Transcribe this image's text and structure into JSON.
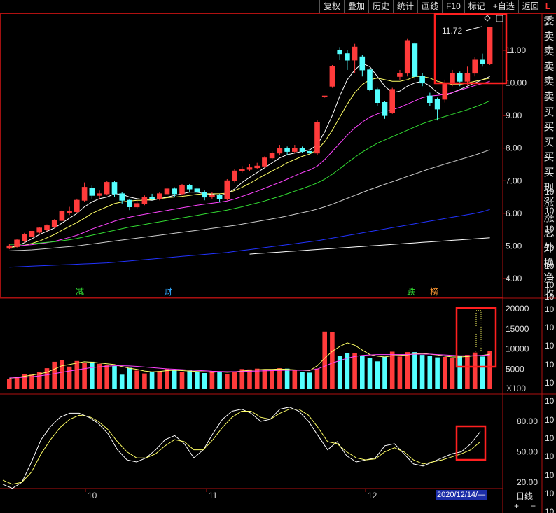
{
  "toolbar": {
    "buttons": [
      "复权",
      "叠加",
      "历史",
      "统计",
      "画线",
      "F10",
      "标记",
      "+自选",
      "返回"
    ],
    "flag": "L"
  },
  "side_panel": [
    "委",
    "卖",
    "卖",
    "卖",
    "卖",
    "卖",
    "买",
    "买",
    "买",
    "买",
    "买",
    "现",
    "涨",
    "涨",
    "总",
    "外",
    "换",
    "净",
    "收"
  ],
  "bottom": {
    "period": "日线",
    "date_box": "2020/12/14/—",
    "plus": "+",
    "minus": "−",
    "x100": "X100"
  },
  "price_axis": [
    "11.00",
    "10.00",
    "9.00",
    "8.00",
    "7.00",
    "6.00",
    "5.00",
    "4.00"
  ],
  "volume_axis": [
    "20000",
    "15000",
    "10000",
    "5000"
  ],
  "kdj_axis": [
    "80.00",
    "50.00",
    "20.00"
  ],
  "right_marks": [
    "10",
    "10",
    "10",
    "10",
    "10",
    "10",
    "10",
    "10",
    "10",
    "10",
    "10",
    "10",
    "10",
    "10",
    "10",
    "10",
    "10",
    "10",
    "10",
    "10"
  ],
  "dates": [
    "10",
    "11",
    "12"
  ],
  "markers": [
    {
      "text": "减",
      "color": "#33dd33"
    },
    {
      "text": "财",
      "color": "#33aaff"
    },
    {
      "text": "跌",
      "color": "#33dd33"
    },
    {
      "text": "榜",
      "color": "#ff9933"
    }
  ],
  "annotation": {
    "high_label": "11.72"
  },
  "colors": {
    "up": "#ff3b3b",
    "down": "#54ffff",
    "ma_white": "#ffffff",
    "ma_yellow": "#ffff66",
    "ma_magenta": "#ff44ff",
    "ma_green": "#33dd33",
    "ma_gray": "#cccccc",
    "ma_blue": "#2233ff",
    "highlight_box": "#ff2020"
  },
  "chart_data": {
    "type": "candlestick",
    "price_ylim": [
      3.6,
      12.6
    ],
    "volume_ylim": [
      0,
      22000
    ],
    "kdj_ylim": [
      10,
      100
    ],
    "candles": [
      [
        4.93,
        5.0,
        4.9,
        5.05
      ],
      [
        4.98,
        5.18,
        4.95,
        5.2
      ],
      [
        5.15,
        5.35,
        5.1,
        5.4
      ],
      [
        5.3,
        5.45,
        5.25,
        5.5
      ],
      [
        5.42,
        5.55,
        5.38,
        5.58
      ],
      [
        5.5,
        5.62,
        5.45,
        5.66
      ],
      [
        5.6,
        5.78,
        5.55,
        5.82
      ],
      [
        5.78,
        6.05,
        5.72,
        6.1
      ],
      [
        6.05,
        6.05,
        5.95,
        6.2
      ],
      [
        6.05,
        6.4,
        6.0,
        6.45
      ],
      [
        6.4,
        6.8,
        6.35,
        6.95
      ],
      [
        6.78,
        6.55,
        6.45,
        6.85
      ],
      [
        6.55,
        6.6,
        6.45,
        6.7
      ],
      [
        6.6,
        6.95,
        6.55,
        7.0
      ],
      [
        6.95,
        6.6,
        6.5,
        7.0
      ],
      [
        6.6,
        6.4,
        6.3,
        6.65
      ],
      [
        6.4,
        6.2,
        6.1,
        6.45
      ],
      [
        6.2,
        6.3,
        6.15,
        6.4
      ],
      [
        6.3,
        6.5,
        6.25,
        6.55
      ],
      [
        6.5,
        6.45,
        6.4,
        6.6
      ],
      [
        6.45,
        6.6,
        6.4,
        6.65
      ],
      [
        6.6,
        6.75,
        6.55,
        6.8
      ],
      [
        6.75,
        6.6,
        6.5,
        6.8
      ],
      [
        6.6,
        6.85,
        6.55,
        6.9
      ],
      [
        6.85,
        6.75,
        6.65,
        6.9
      ],
      [
        6.75,
        6.65,
        6.55,
        6.8
      ],
      [
        6.65,
        6.5,
        6.4,
        6.7
      ],
      [
        6.5,
        6.55,
        6.45,
        6.65
      ],
      [
        6.55,
        6.45,
        6.35,
        6.6
      ],
      [
        6.45,
        7.0,
        6.4,
        7.05
      ],
      [
        7.0,
        7.3,
        6.95,
        7.35
      ],
      [
        7.3,
        7.35,
        7.25,
        7.45
      ],
      [
        7.35,
        7.4,
        7.3,
        7.5
      ],
      [
        7.4,
        7.45,
        7.35,
        7.55
      ],
      [
        7.45,
        7.7,
        7.4,
        7.75
      ],
      [
        7.7,
        7.85,
        7.65,
        7.9
      ],
      [
        7.85,
        8.0,
        7.8,
        8.1
      ],
      [
        8.0,
        7.9,
        7.8,
        8.05
      ],
      [
        7.9,
        8.0,
        7.85,
        8.1
      ],
      [
        8.0,
        7.9,
        7.85,
        8.05
      ],
      [
        7.9,
        7.85,
        7.8,
        7.95
      ],
      [
        7.85,
        8.8,
        7.8,
        8.85
      ],
      [
        9.6,
        9.6,
        9.55,
        9.6
      ],
      [
        9.9,
        10.5,
        9.85,
        10.55
      ],
      [
        11.0,
        10.9,
        10.7,
        11.1
      ],
      [
        10.9,
        10.7,
        10.4,
        11.0
      ],
      [
        10.7,
        11.1,
        10.3,
        11.2
      ],
      [
        10.8,
        10.4,
        10.2,
        10.85
      ],
      [
        10.4,
        9.8,
        9.75,
        10.45
      ],
      [
        9.8,
        9.4,
        9.3,
        9.85
      ],
      [
        9.4,
        9.0,
        8.9,
        9.45
      ],
      [
        9.1,
        9.8,
        9.05,
        9.85
      ],
      [
        10.2,
        10.3,
        10.1,
        10.4
      ],
      [
        10.3,
        11.3,
        10.2,
        11.35
      ],
      [
        11.2,
        10.2,
        10.1,
        11.25
      ],
      [
        10.2,
        10.0,
        9.9,
        10.3
      ],
      [
        9.6,
        9.4,
        9.3,
        9.7
      ],
      [
        9.5,
        9.2,
        8.85,
        9.55
      ],
      [
        9.5,
        10.0,
        9.4,
        10.1
      ],
      [
        10.0,
        10.3,
        9.9,
        10.4
      ],
      [
        10.3,
        10.05,
        9.9,
        10.35
      ],
      [
        10.05,
        10.3,
        9.95,
        10.5
      ],
      [
        10.3,
        10.7,
        10.2,
        10.8
      ],
      [
        10.7,
        10.6,
        10.5,
        10.9
      ],
      [
        10.6,
        11.7,
        10.55,
        11.72
      ]
    ],
    "volumes": [
      2500,
      2800,
      3800,
      3600,
      4200,
      5200,
      6800,
      7300,
      5600,
      7000,
      6500,
      6800,
      6300,
      6000,
      5800,
      3600,
      5300,
      4600,
      3900,
      4200,
      4500,
      5100,
      4600,
      4200,
      4600,
      4300,
      4000,
      4500,
      4300,
      3800,
      4400,
      5000,
      4900,
      5100,
      4900,
      4700,
      5200,
      5100,
      4600,
      4300,
      4100,
      5100,
      14300,
      14100,
      8200,
      9000,
      8900,
      8300,
      7800,
      6900,
      8100,
      9300,
      8100,
      9200,
      9200,
      8500,
      8300,
      7900,
      8000,
      7700,
      8200,
      8500,
      9100,
      8100,
      9400
    ],
    "ma": [
      {
        "color": "ffffff",
        "values": [
          4.95,
          5.0,
          5.1,
          5.22,
          5.35,
          5.45,
          5.55,
          5.7,
          5.85,
          6.0,
          6.2,
          6.35,
          6.45,
          6.5,
          6.6,
          6.58,
          6.5,
          6.45,
          6.42,
          6.4,
          6.45,
          6.5,
          6.55,
          6.6,
          6.65,
          6.65,
          6.6,
          6.58,
          6.55,
          6.6,
          6.75,
          6.95,
          7.1,
          7.25,
          7.4,
          7.55,
          7.7,
          7.8,
          7.85,
          7.9,
          7.95,
          8.1,
          8.5,
          9.0,
          9.6,
          10.1,
          10.4,
          10.6,
          10.5,
          10.2,
          9.9,
          9.7,
          9.75,
          9.9,
          10.0,
          10.05,
          9.9,
          9.7,
          9.6,
          9.7,
          9.8,
          9.9,
          10.0,
          10.1,
          10.2
        ]
      },
      {
        "color": "ffff66",
        "values": [
          4.95,
          4.98,
          5.02,
          5.08,
          5.15,
          5.25,
          5.35,
          5.48,
          5.6,
          5.72,
          5.85,
          6.0,
          6.1,
          6.2,
          6.3,
          6.35,
          6.38,
          6.4,
          6.4,
          6.42,
          6.45,
          6.48,
          6.5,
          6.52,
          6.55,
          6.58,
          6.6,
          6.6,
          6.6,
          6.62,
          6.7,
          6.8,
          6.92,
          7.05,
          7.18,
          7.3,
          7.42,
          7.55,
          7.65,
          7.75,
          7.82,
          7.95,
          8.2,
          8.55,
          8.95,
          9.35,
          9.7,
          9.95,
          10.1,
          10.15,
          10.1,
          10.05,
          10.05,
          10.1,
          10.2,
          10.2,
          10.15,
          10.05,
          10.0,
          9.95,
          9.95,
          10.0,
          10.05,
          10.1,
          10.15
        ]
      },
      {
        "color": "ff44ff",
        "values": [
          5.0,
          5.0,
          5.02,
          5.04,
          5.07,
          5.1,
          5.14,
          5.2,
          5.26,
          5.33,
          5.42,
          5.52,
          5.6,
          5.68,
          5.76,
          5.83,
          5.88,
          5.93,
          5.97,
          6.01,
          6.05,
          6.09,
          6.13,
          6.17,
          6.21,
          6.25,
          6.28,
          6.31,
          6.34,
          6.38,
          6.44,
          6.52,
          6.6,
          6.68,
          6.77,
          6.86,
          6.95,
          7.05,
          7.15,
          7.25,
          7.33,
          7.45,
          7.65,
          7.9,
          8.15,
          8.4,
          8.62,
          8.8,
          8.95,
          9.05,
          9.12,
          9.18,
          9.25,
          9.35,
          9.45,
          9.55,
          9.6,
          9.62,
          9.65,
          9.7,
          9.78,
          9.85,
          9.92,
          9.98,
          10.05
        ]
      },
      {
        "color": "33dd33",
        "values": [
          5.05,
          5.05,
          5.06,
          5.07,
          5.09,
          5.11,
          5.13,
          5.16,
          5.19,
          5.23,
          5.28,
          5.33,
          5.38,
          5.43,
          5.48,
          5.53,
          5.58,
          5.62,
          5.66,
          5.7,
          5.74,
          5.78,
          5.82,
          5.86,
          5.9,
          5.94,
          5.98,
          6.02,
          6.06,
          6.1,
          6.15,
          6.2,
          6.26,
          6.32,
          6.38,
          6.45,
          6.52,
          6.6,
          6.68,
          6.76,
          6.84,
          6.93,
          7.05,
          7.2,
          7.37,
          7.55,
          7.72,
          7.88,
          8.02,
          8.15,
          8.25,
          8.35,
          8.45,
          8.55,
          8.65,
          8.75,
          8.83,
          8.9,
          8.97,
          9.04,
          9.11,
          9.18,
          9.26,
          9.35,
          9.45
        ]
      },
      {
        "color": "cccccc",
        "values": [
          4.85,
          4.86,
          4.87,
          4.88,
          4.9,
          4.92,
          4.94,
          4.96,
          4.98,
          5.0,
          5.03,
          5.06,
          5.09,
          5.12,
          5.15,
          5.18,
          5.21,
          5.24,
          5.27,
          5.3,
          5.33,
          5.36,
          5.39,
          5.42,
          5.45,
          5.48,
          5.51,
          5.54,
          5.57,
          5.6,
          5.63,
          5.67,
          5.71,
          5.75,
          5.79,
          5.83,
          5.87,
          5.92,
          5.97,
          6.02,
          6.07,
          6.13,
          6.2,
          6.28,
          6.37,
          6.46,
          6.55,
          6.64,
          6.73,
          6.81,
          6.89,
          6.97,
          7.05,
          7.13,
          7.21,
          7.29,
          7.37,
          7.44,
          7.51,
          7.58,
          7.65,
          7.72,
          7.79,
          7.87,
          7.95
        ]
      },
      {
        "color": "2233ff",
        "values": [
          4.35,
          4.36,
          4.37,
          4.38,
          4.39,
          4.4,
          4.41,
          4.42,
          4.43,
          4.44,
          4.45,
          4.46,
          4.47,
          4.48,
          4.5,
          4.52,
          4.54,
          4.56,
          4.58,
          4.6,
          4.62,
          4.64,
          4.66,
          4.68,
          4.7,
          4.72,
          4.74,
          4.76,
          4.78,
          4.8,
          4.83,
          4.86,
          4.89,
          4.92,
          4.95,
          4.98,
          5.01,
          5.04,
          5.07,
          5.1,
          5.13,
          5.16,
          5.2,
          5.24,
          5.28,
          5.32,
          5.36,
          5.4,
          5.44,
          5.48,
          5.52,
          5.56,
          5.6,
          5.64,
          5.68,
          5.72,
          5.76,
          5.8,
          5.84,
          5.88,
          5.92,
          5.96,
          6.0,
          6.05,
          6.12
        ]
      }
    ],
    "ma250": {
      "start_index": 32,
      "values_range": [
        4.75,
        5.25
      ]
    },
    "volume_ma": [
      {
        "color": "ffff66",
        "values": [
          2700,
          2900,
          3200,
          3500,
          3800,
          4200,
          5000,
          5800,
          6100,
          6500,
          6800,
          6700,
          6500,
          6300,
          6100,
          5600,
          5200,
          4900,
          4500,
          4300,
          4400,
          4600,
          4700,
          4600,
          4500,
          4400,
          4300,
          4200,
          4300,
          4200,
          4300,
          4500,
          4700,
          4800,
          4900,
          4900,
          5000,
          4900,
          4800,
          4700,
          4600,
          5800,
          7700,
          9400,
          10600,
          11500,
          10900,
          9700,
          8600,
          8200,
          8000,
          8300,
          8400,
          8500,
          8800,
          8900,
          8700,
          8500,
          8200,
          8000,
          8000,
          8100,
          8300,
          8400,
          8700
        ]
      },
      {
        "color": "ff44ff",
        "values": [
          2800,
          2850,
          2950,
          3100,
          3300,
          3550,
          3850,
          4200,
          4500,
          4800,
          5100,
          5350,
          5550,
          5700,
          5800,
          5800,
          5750,
          5650,
          5500,
          5350,
          5200,
          5050,
          4950,
          4850,
          4750,
          4650,
          4550,
          4450,
          4400,
          4350,
          4350,
          4400,
          4450,
          4500,
          4550,
          4600,
          4650,
          4700,
          4700,
          4700,
          4700,
          5000,
          5700,
          6500,
          7100,
          7700,
          8100,
          8400,
          8500,
          8600,
          8600,
          8600,
          8600,
          8600,
          8700,
          8700,
          8700,
          8600,
          8500,
          8400,
          8300,
          8300,
          8300,
          8400,
          8500
        ]
      }
    ],
    "kdj": {
      "k": [
        18,
        14,
        20,
        40,
        62,
        75,
        84,
        88,
        88,
        84,
        78,
        68,
        52,
        42,
        40,
        44,
        52,
        62,
        66,
        58,
        44,
        52,
        68,
        82,
        90,
        92,
        88,
        80,
        82,
        92,
        94,
        90,
        80,
        66,
        52,
        60,
        46,
        40,
        42,
        44,
        56,
        58,
        48,
        38,
        36,
        40,
        44,
        48,
        50,
        58,
        70
      ],
      "d": [
        22,
        18,
        20,
        30,
        48,
        62,
        74,
        82,
        86,
        85,
        80,
        72,
        60,
        50,
        44,
        44,
        48,
        56,
        62,
        60,
        52,
        52,
        62,
        74,
        84,
        90,
        90,
        84,
        82,
        88,
        92,
        92,
        86,
        74,
        60,
        58,
        50,
        44,
        42,
        43,
        50,
        54,
        50,
        42,
        38,
        40,
        42,
        45,
        48,
        52,
        60
      ]
    }
  }
}
